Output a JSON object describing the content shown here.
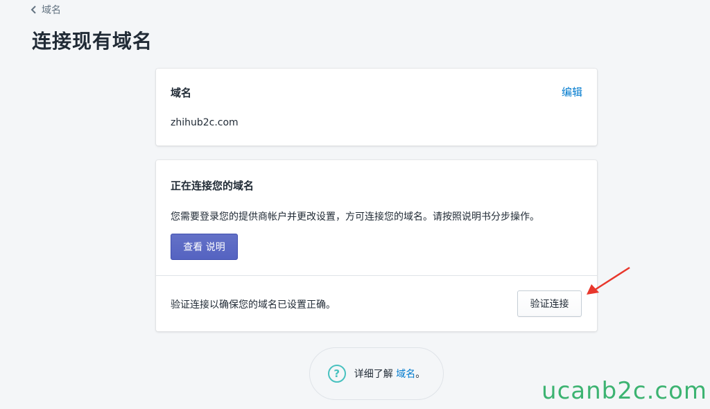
{
  "breadcrumb": {
    "label": "域名"
  },
  "page_title": "连接现有域名",
  "domain_card": {
    "heading": "域名",
    "edit_label": "编辑",
    "domain": "zhihub2c.com"
  },
  "connect_card": {
    "heading": "正在连接您的域名",
    "description": "您需要登录您的提供商帐户并更改设置，方可连接您的域名。请按照说明书分步操作。",
    "view_button": "查看 说明",
    "verify_text": "验证连接以确保您的域名已设置正确。",
    "verify_button": "验证连接"
  },
  "help": {
    "icon": "question-circle-icon",
    "prefix": "详细了解 ",
    "link": "域名",
    "suffix": "。"
  },
  "watermark": "ucanb2c.com",
  "colors": {
    "background": "#f4f6f8",
    "link": "#007ace",
    "primary_button": "#5c6ac4",
    "help_icon": "#47c1bf",
    "arrow": "#e8372c",
    "watermark": "#3cb371"
  }
}
